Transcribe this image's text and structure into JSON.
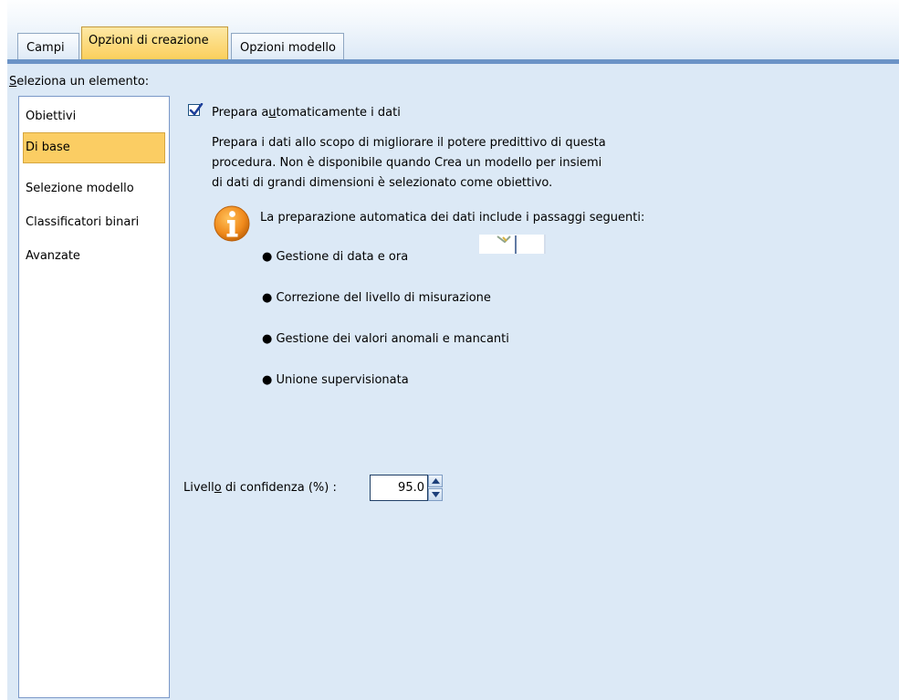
{
  "tabs": [
    {
      "label": "Campi",
      "active": false
    },
    {
      "label": "Opzioni di creazione",
      "active": true
    },
    {
      "label": "Opzioni modello",
      "active": false
    }
  ],
  "select_label": {
    "before": "",
    "mnemonic": "S",
    "after": "eleziona un elemento:"
  },
  "list_items": [
    {
      "label": "Obiettivi",
      "selected": false
    },
    {
      "label": "Di base",
      "selected": true
    },
    {
      "label": "Selezione modello",
      "selected": false
    },
    {
      "label": "Classificatori binari",
      "selected": false
    },
    {
      "label": "Avanzate",
      "selected": false
    }
  ],
  "auto_prep": {
    "checked": true,
    "label_before": "Prepara a",
    "label_mnemonic": "u",
    "label_after": "tomaticamente i dati",
    "description_lines": [
      "Prepara i dati allo scopo di migliorare il potere predittivo di questa",
      "procedura. Non è disponibile quando Crea un modello per insiemi",
      "di dati di grandi dimensioni è selezionato come obiettivo."
    ]
  },
  "info": {
    "icon": "info-icon",
    "heading": "La preparazione automatica dei dati include i passaggi seguenti:",
    "bullets": [
      "● Gestione di data e ora",
      "● Correzione del livello di misurazione",
      "● Gestione dei valori anomali e mancanti",
      "● Unione supervisionata"
    ]
  },
  "confidence": {
    "label_before": "Livell",
    "label_mnemonic": "o",
    "label_after": " di confidenza (%) :",
    "value": "95.0"
  },
  "colors": {
    "panel_bg": "#dce9f6",
    "active_tab": "#fbcf5c",
    "selected_item": "#fbcd63",
    "tab_underline": "#6b93c6",
    "info_orange": "#f08a1c"
  }
}
